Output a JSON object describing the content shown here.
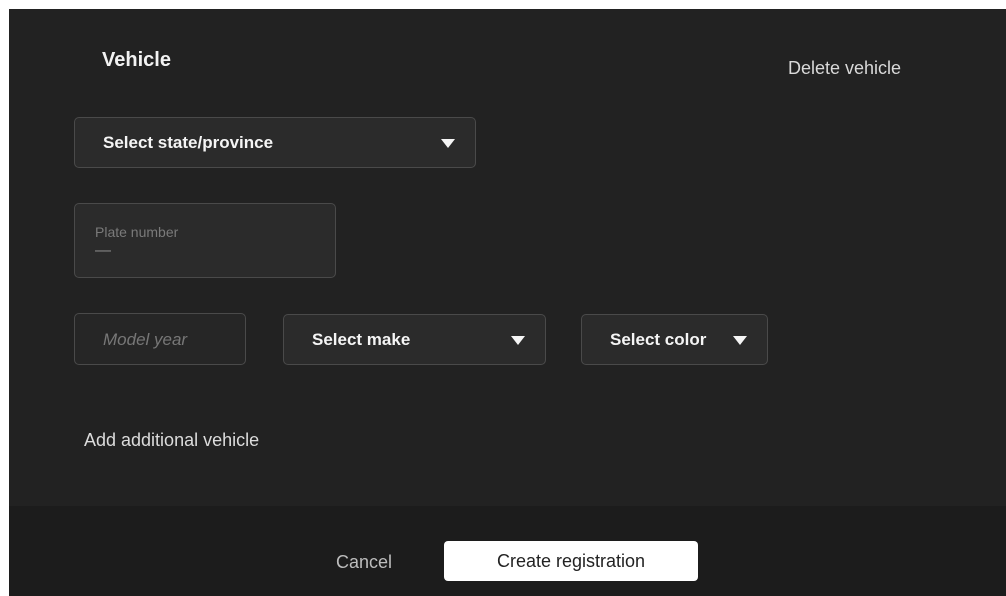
{
  "vehicle_section": {
    "title": "Vehicle",
    "delete_label": "Delete vehicle",
    "state_select": {
      "selected": "Select state/province"
    },
    "plate_field": {
      "label": "Plate number",
      "value": "—"
    },
    "model_year": {
      "placeholder": "Model year"
    },
    "make_select": {
      "selected": "Select make"
    },
    "color_select": {
      "selected": "Select color"
    },
    "add_vehicle_label": "Add additional vehicle"
  },
  "footer": {
    "cancel_label": "Cancel",
    "create_label": "Create registration"
  },
  "icons": {
    "dropdown": "chevron-down-icon"
  },
  "colors": {
    "panel_background": "#222222",
    "footer_background": "#1c1c1c",
    "primary_button": "#ffffff"
  }
}
